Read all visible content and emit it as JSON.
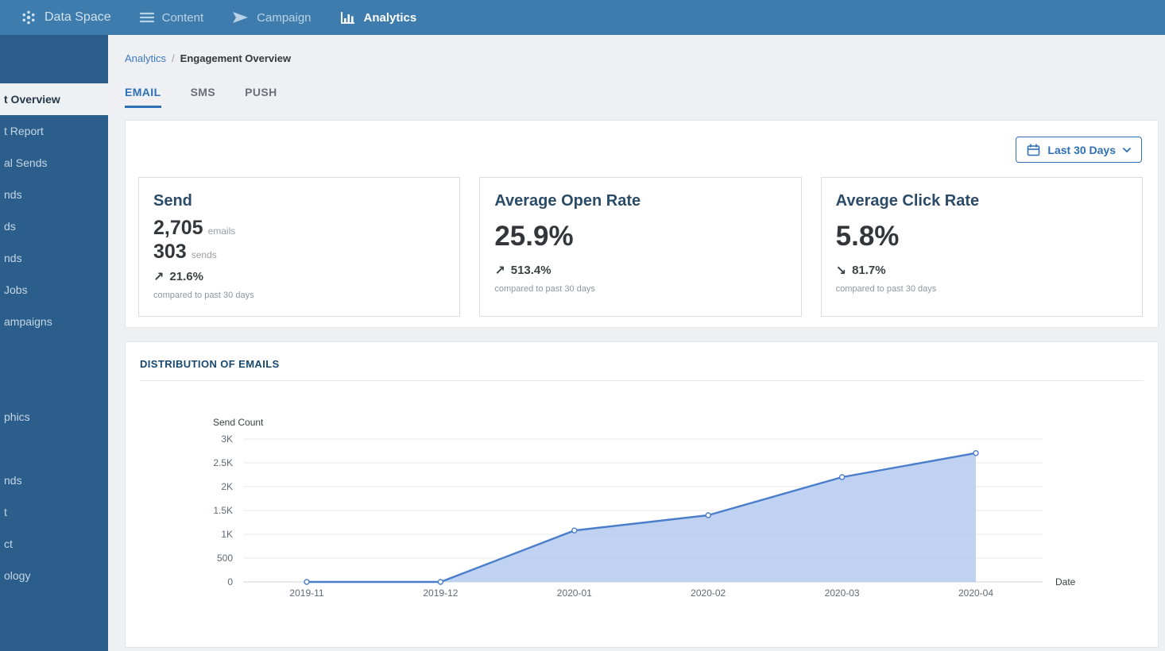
{
  "topbar": {
    "brand": "Data Space",
    "nav": [
      {
        "label": "Content",
        "active": false
      },
      {
        "label": "Campaign",
        "active": false
      },
      {
        "label": "Analytics",
        "active": true
      }
    ]
  },
  "sidebar": {
    "items": [
      {
        "label": "t Overview",
        "active": true
      },
      {
        "label": "t Report",
        "active": false
      },
      {
        "label": "al Sends",
        "active": false
      },
      {
        "label": "nds",
        "active": false
      },
      {
        "label": "ds",
        "active": false
      },
      {
        "label": "nds",
        "active": false
      },
      {
        "label": "Jobs",
        "active": false
      },
      {
        "label": "ampaigns",
        "active": false
      },
      {
        "label": "phics",
        "active": false
      },
      {
        "label": "nds",
        "active": false
      },
      {
        "label": "t",
        "active": false
      },
      {
        "label": "ct",
        "active": false
      },
      {
        "label": "ology",
        "active": false
      }
    ]
  },
  "breadcrumb": {
    "parent": "Analytics",
    "separator": "/",
    "current": "Engagement Overview"
  },
  "tabs": [
    {
      "label": "EMAIL",
      "active": true
    },
    {
      "label": "SMS",
      "active": false
    },
    {
      "label": "PUSH",
      "active": false
    }
  ],
  "date_filter": {
    "label": "Last 30 Days"
  },
  "stats": {
    "send": {
      "title": "Send",
      "value1": "2,705",
      "unit1": "emails",
      "value2": "303",
      "unit2": "sends",
      "arrow": "↗",
      "trend": "up",
      "change": "21.6%",
      "note": "compared to past 30 days"
    },
    "open_rate": {
      "title": "Average Open Rate",
      "value": "25.9%",
      "arrow": "↗",
      "trend": "up",
      "change": "513.4%",
      "note": "compared to past 30 days"
    },
    "click_rate": {
      "title": "Average Click Rate",
      "value": "5.8%",
      "arrow": "↘",
      "trend": "down",
      "change": "81.7%",
      "note": "compared to past 30 days"
    }
  },
  "chart_data": {
    "type": "area",
    "title": "DISTRIBUTION OF EMAILS",
    "x": [
      "2019-11",
      "2019-12",
      "2020-01",
      "2020-02",
      "2020-03",
      "2020-04"
    ],
    "values": [
      0,
      0,
      1080,
      1400,
      2200,
      2705
    ],
    "ylabel": "Send Count",
    "xlabel": "Date",
    "ylim": [
      0,
      3000
    ],
    "ytick_labels": [
      "3K",
      "2.5K",
      "2K",
      "1.5K",
      "1K",
      "500",
      "0"
    ],
    "grid": true,
    "legend": "none",
    "line_color": "#4a7dca",
    "area_color": "#b9cdf1"
  },
  "colors": {
    "accent": "#2f6fb5",
    "topbar": "#3d7cac",
    "sidebar": "#2c5e8c"
  }
}
